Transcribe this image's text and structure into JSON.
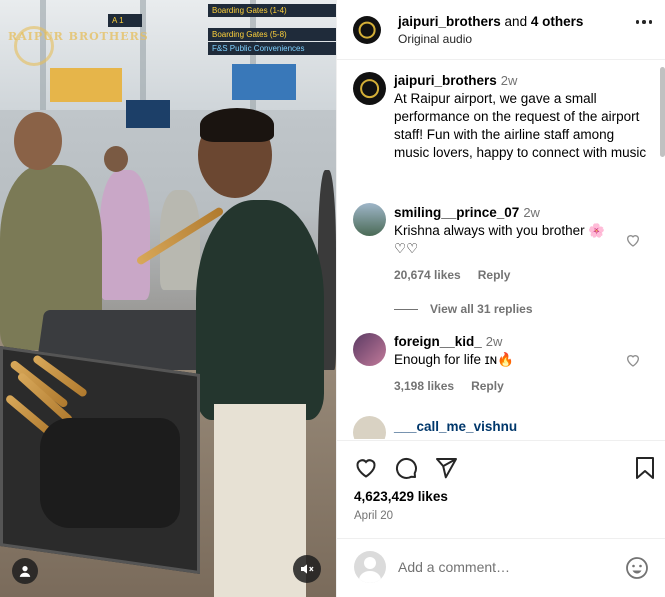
{
  "media": {
    "signs": [
      "Boarding Gates (1-4)",
      "Boarding Gates (5-8)",
      "F&S Public Conveniences"
    ],
    "watermark": "RAIPUR BROTHERS",
    "profile_icon": "user-icon",
    "mute_icon": "speaker-muted-icon"
  },
  "header": {
    "username": "jaipuri_brothers",
    "and_text": "and",
    "others": "4 others",
    "subtitle": "Original audio",
    "more_icon": "more-dots-icon"
  },
  "caption": {
    "username": "jaipuri_brothers",
    "time": "2w",
    "text": "At Raipur airport, we gave a small performance on the request of the airport staff! Fun with the airline staff among music lovers, happy to connect with music"
  },
  "comments": [
    {
      "username": "smiling__prince_07",
      "time": "2w",
      "text": "Krishna always with you brother 🌸 ♡♡",
      "likes": "20,674 likes",
      "reply": "Reply",
      "view_replies": "View all 31 replies"
    },
    {
      "username": "foreign__kid_",
      "time": "2w",
      "text": "Enough for life ɪɴ🔥",
      "likes": "3,198 likes",
      "reply": "Reply"
    },
    {
      "username": "___call_me_vishnu"
    }
  ],
  "actions": {
    "like_icon": "heart-icon",
    "comment_icon": "comment-icon",
    "share_icon": "send-icon",
    "save_icon": "bookmark-icon",
    "likes": "4,623,429 likes",
    "date": "April 20"
  },
  "add_comment": {
    "placeholder": "Add a comment…",
    "emoji_icon": "emoji-icon"
  },
  "colors": {
    "muted": "#737373",
    "border": "#efefef",
    "accent_gold": "#d4af37"
  }
}
